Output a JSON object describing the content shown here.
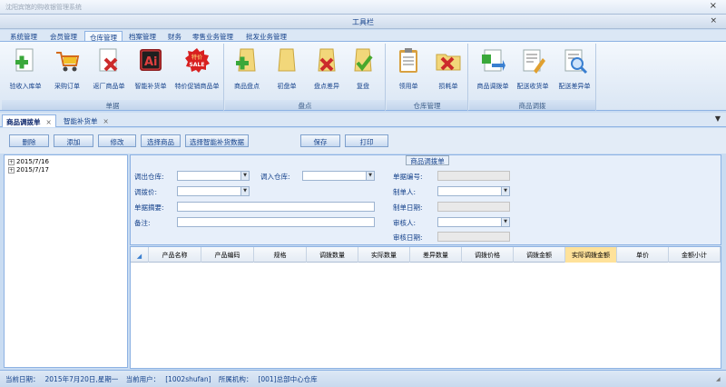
{
  "window": {
    "title": "沈阳宾馆的购收银管理系统"
  },
  "toolbar_caption": "工具栏",
  "ribbon_tabs": [
    "系统管理",
    "会员管理",
    "仓库管理",
    "档案管理",
    "财务",
    "零售业务管理",
    "批发业务管理"
  ],
  "ribbon_groups": [
    {
      "label": "单据",
      "buttons": [
        {
          "label": "验收入库单",
          "icon": "document-add-icon",
          "color": "#3aa83a"
        },
        {
          "label": "采购订单",
          "icon": "shopping-cart-icon",
          "color": "#e8b020"
        },
        {
          "label": "返厂商品单",
          "icon": "document-cancel-icon",
          "color": "#cc2b2b"
        },
        {
          "label": "智能补货单",
          "icon": "ai-icon",
          "color": "#b3262a"
        },
        {
          "label": "特价促销商品单",
          "icon": "sale-badge-icon",
          "color": "#d82020",
          "badge_top": "特价",
          "badge_bottom": "SALE"
        }
      ]
    },
    {
      "label": "盘点",
      "buttons": [
        {
          "label": "商品盘点",
          "icon": "folder-add-icon",
          "color": "#3aa83a"
        },
        {
          "label": "初盘单",
          "icon": "folder-icon",
          "color": "#e8c050"
        },
        {
          "label": "盘点差异",
          "icon": "folder-cancel-icon",
          "color": "#cc2b2b"
        },
        {
          "label": "复盘",
          "icon": "folder-check-icon",
          "color": "#49a82d"
        }
      ]
    },
    {
      "label": "仓库管理",
      "buttons": [
        {
          "label": "领用单",
          "icon": "clipboard-icon",
          "color": "#d8a040"
        },
        {
          "label": "损耗单",
          "icon": "broken-folder-icon",
          "color": "#cc2b2b"
        }
      ]
    },
    {
      "label": "商品调拨",
      "buttons": [
        {
          "label": "商品调拨单",
          "icon": "transfer-icon",
          "color": "#3a7fd0"
        },
        {
          "label": "配送收货单",
          "icon": "receipt-icon",
          "color": "#e0a030"
        },
        {
          "label": "配送差异单",
          "icon": "search-document-icon",
          "color": "#3a7fd0"
        }
      ]
    }
  ],
  "doc_tabs": [
    {
      "label": "商品调拨单",
      "active": true
    },
    {
      "label": "智能补货单",
      "active": false
    }
  ],
  "close_glyph": "×",
  "tab_menu_glyph": "▼",
  "actions": [
    "删除",
    "添加",
    "修改",
    "选择商品",
    "选择智能补货数据",
    "保存",
    "打印"
  ],
  "tree": [
    {
      "label": "2015/7/16",
      "toggle": "+"
    },
    {
      "label": "2015/7/17",
      "toggle": "+"
    }
  ],
  "form": {
    "legend": "商品调拨单",
    "out_warehouse": {
      "label": "调出仓库:",
      "value": ""
    },
    "in_warehouse": {
      "label": "调入仓库:",
      "value": ""
    },
    "doc_no": {
      "label": "单据编号:",
      "value": ""
    },
    "transfer_price": {
      "label": "调拨价:",
      "value": ""
    },
    "maker": {
      "label": "制单人:",
      "value": ""
    },
    "summary": {
      "label": "单据摘要:",
      "value": ""
    },
    "make_date": {
      "label": "制单日期:",
      "value": ""
    },
    "remark": {
      "label": "备注:",
      "value": ""
    },
    "auditor": {
      "label": "审核人:",
      "value": ""
    },
    "audit_date": {
      "label": "审核日期:",
      "value": ""
    }
  },
  "grid": {
    "sort_glyph": "◢",
    "columns": [
      "产品名称",
      "产品编码",
      "规格",
      "调拨数量",
      "实际数量",
      "差异数量",
      "调拨价格",
      "调拨金额",
      "实际调拨金额",
      "单价",
      "金额小计"
    ],
    "highlight_column": "实际调拨金额",
    "rows": []
  },
  "status": {
    "date_label": "当前日期：",
    "date": "2015年7月20日,星期一",
    "user_label": "当前用户：",
    "user": "[1002shufan]",
    "org_label": "所属机构：",
    "org": "[001]总部中心仓库"
  }
}
